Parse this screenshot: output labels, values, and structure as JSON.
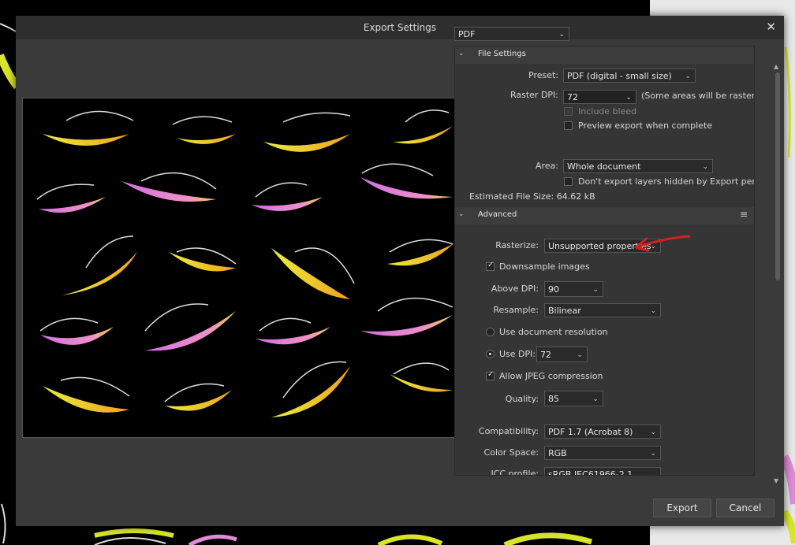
{
  "dialog": {
    "title": "Export Settings"
  },
  "format": {
    "value": "PDF"
  },
  "file_settings": {
    "header": "File Settings",
    "preset_label": "Preset:",
    "preset_value": "PDF (digital - small size)",
    "raster_dpi_label": "Raster DPI:",
    "raster_dpi_value": "72",
    "raster_note": "(Some areas will be rasterized)",
    "include_bleed": "Include bleed",
    "preview_export": "Preview export when complete",
    "area_label": "Area:",
    "area_value": "Whole document",
    "dont_export_hidden": "Don't export layers hidden by Export persona",
    "estimated_size": "Estimated File Size: 64.62 kB"
  },
  "advanced": {
    "header": "Advanced",
    "rasterize_label": "Rasterize:",
    "rasterize_value": "Unsupported properties",
    "downsample": "Downsample images",
    "above_dpi_label": "Above DPI:",
    "above_dpi_value": "90",
    "resample_label": "Resample:",
    "resample_value": "Bilinear",
    "use_doc_res": "Use document resolution",
    "use_dpi": "Use DPI:",
    "use_dpi_value": "72",
    "allow_jpeg": "Allow JPEG compression",
    "quality_label": "Quality:",
    "quality_value": "85",
    "compat_label": "Compatibility:",
    "compat_value": "PDF 1.7 (Acrobat 8)",
    "color_space_label": "Color Space:",
    "color_space_value": "RGB",
    "icc_label": "ICC profile:",
    "icc_value": "sRGB IEC61966-2.1"
  },
  "buttons": {
    "export": "Export",
    "cancel": "Cancel"
  },
  "colors": {
    "annotation_arrow": "#d42020",
    "lash_yellow": "#d8e62a",
    "lash_pink": "#e08ad8"
  }
}
